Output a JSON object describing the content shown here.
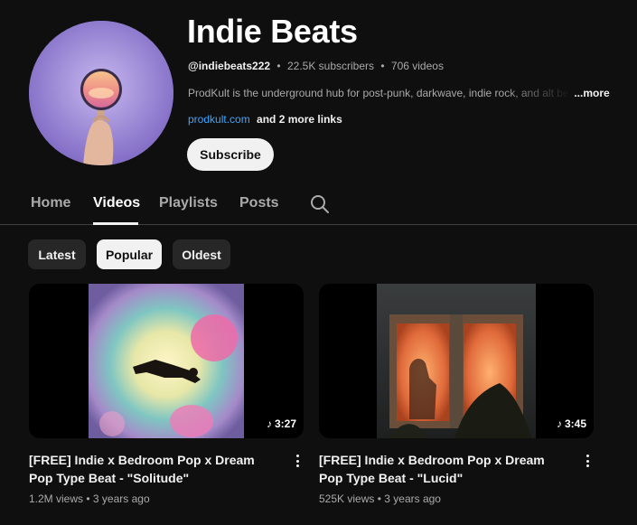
{
  "channel": {
    "name": "Indie Beats",
    "handle": "@indiebeats222",
    "subscribers": "22.5K subscribers",
    "videos_count": "706 videos",
    "separator": "•",
    "description": "ProdKult is the underground hub for post-punk, darkwave, indie rock, and alt beats",
    "description_more": "...more",
    "link": "prodkult.com",
    "more_links": "and 2 more links",
    "subscribe_label": "Subscribe"
  },
  "tabs": [
    {
      "label": "Home",
      "active": false
    },
    {
      "label": "Videos",
      "active": true
    },
    {
      "label": "Playlists",
      "active": false
    },
    {
      "label": "Posts",
      "active": false
    }
  ],
  "chips": [
    {
      "label": "Latest",
      "active": false
    },
    {
      "label": "Popular",
      "active": true
    },
    {
      "label": "Oldest",
      "active": false
    }
  ],
  "videos": [
    {
      "title": "[FREE] Indie x Bedroom Pop x Dream Pop Type Beat - \"Solitude\"",
      "duration": "3:27",
      "views": "1.2M views",
      "age": "3 years ago",
      "meta_separator": "•"
    },
    {
      "title": "[FREE] Indie x Bedroom Pop x Dream Pop Type Beat - \"Lucid\"",
      "duration": "3:45",
      "views": "525K views",
      "age": "3 years ago",
      "meta_separator": "•"
    }
  ],
  "icons": {
    "search": "search-icon",
    "music_note": "music-note-icon",
    "more": "more-vert-icon"
  },
  "colors": {
    "background": "#0f0f0f",
    "link": "#3ea6ff",
    "chip": "#272727",
    "chip_active": "#f1f1f1"
  }
}
